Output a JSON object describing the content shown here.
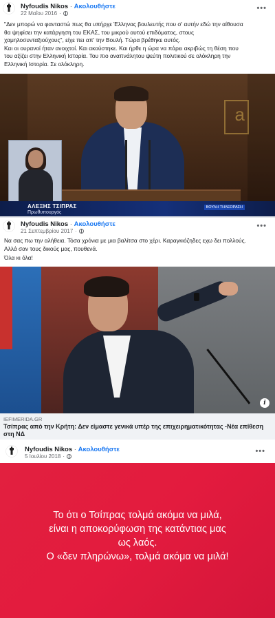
{
  "post1": {
    "author": "Nyfoudis Nikos",
    "separator": "·",
    "follow": "Ακολουθήστε",
    "date": "22 Μαΐου 2016",
    "more": "•••",
    "lines": [
      "\"Δεν μπορώ να φανταστώ πως θα υπήρχε Έλληνας βουλευτής που σ' αυτήν εδώ την αίθουσα",
      "θα ψηφίσει την κατάργηση του ΕΚΑΣ, του μικρού αυτού επιδόματος, στους",
      "χαμηλοσυνταξιούχους\", είχε πει απ' την Βουλή. Τώρα βρέθηκε αυτός.",
      "Και οι ουρανοί ήταν ανοιχτοί. Και ακούστηκε. Και ήρθε η ώρα να πάρει ακριβώς τη θέση που",
      "του αξίζει στην Ελληνική Ιστορία. Του πιο αναπνάλητου ψεύτη πολιτικού σε ολόκληρη την",
      "Ελληνική Ιστορία. Σε ολόκληρη."
    ],
    "caption_name": "ΑΛΕΞΗΣ ΤΣΙΠΡΑΣ",
    "caption_role": "Πρωθυπουργός",
    "channel": "ΒΟΥΛΗ ΤΗΛΕΟΡΑΣΗ",
    "logo_letter": "a"
  },
  "post2": {
    "author": "Nyfoudis Nikos",
    "separator": "·",
    "follow": "Ακολουθήστε",
    "date": "21 Σεπτεμβρίου 2017",
    "more": "•••",
    "lines": [
      "Να σας πω την αλήθεια. Τόσα χρόνια με μια βαλίτσα στο χέρι. Καραγκιόζηδες εχω δει πολλούς.",
      "Αλλά σαν τους δικούς μας, πουθενά.",
      "Όλα κι όλα!"
    ],
    "link_source": "IEFIMERIDA.GR",
    "link_title": "Τσίπρας από την Κρήτη: Δεν είμαστε γενικά υπέρ της επιχειρηματικότητας -Νέα επίθεση στη ΝΔ",
    "info": "i"
  },
  "post3": {
    "author": "Nyfoudis Nikos",
    "separator": "·",
    "follow": "Ακολουθήστε",
    "date": "5 Ιουλίου 2018",
    "more": "•••",
    "quote_lines": [
      "Το ότι ο Τσίπρας τολμά ακόμα να μιλά,",
      "είναι η αποκορύφωση της κατάντιας μας",
      "ως λαός.",
      "Ο «δεν πληρώνω», τολμά ακόμα να μιλά!"
    ]
  },
  "colors": {
    "link_blue": "#1877f2",
    "red_background": "#e31b3e",
    "meta_gray": "#65676b"
  },
  "icons": {
    "avatar": "crest-avatar-icon",
    "privacy": "globe-icon",
    "more": "more-options-icon",
    "info": "info-icon"
  }
}
